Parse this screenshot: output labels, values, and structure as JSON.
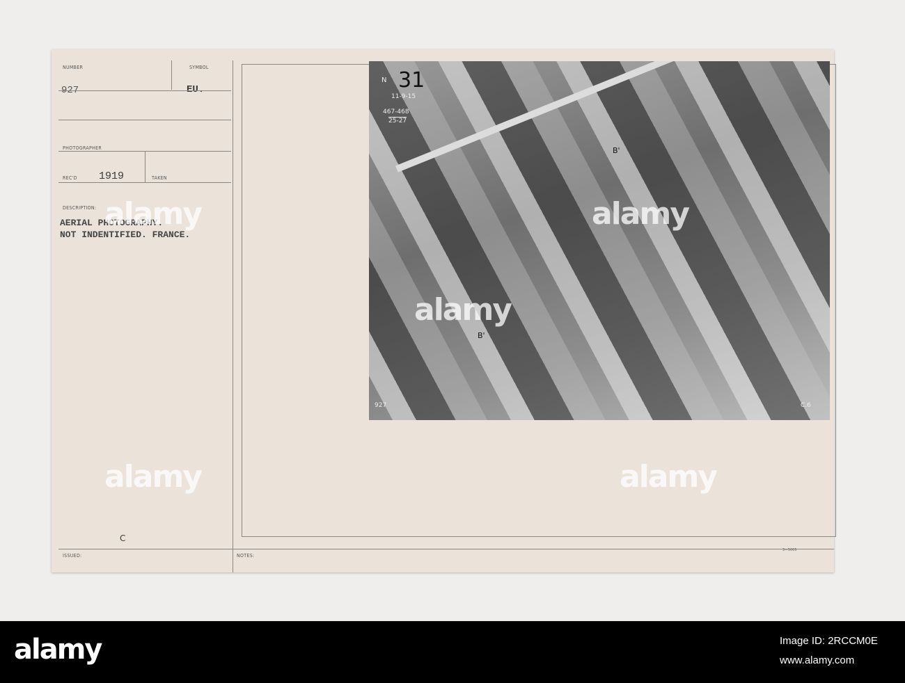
{
  "form": {
    "number_label": "NUMBER",
    "number_value": "927",
    "symbol_label": "SYMBOL",
    "symbol_value": "EU.",
    "photographer_label": "PHOTOGRAPHER",
    "recd_label": "REC'D",
    "recd_value": "1919",
    "taken_label": "TAKEN",
    "description_label": "DESCRIPTION:",
    "description_line1": "AERIAL PHOTOGRAPHY.",
    "description_line2": "NOT INDENTIFIED. FRANCE.",
    "class_mark": "C",
    "issued_label": "ISSUED:",
    "notes_label": "NOTES:",
    "form_code": "3—5005"
  },
  "photo": {
    "plate_number": "31",
    "north": "N",
    "date": "11-9-15",
    "ref1": "467-468",
    "ref2": "25-27",
    "marker1": "B'",
    "marker2": "B'",
    "corner_left": "927",
    "corner_right": "C.6"
  },
  "watermark": {
    "text": "alamy",
    "image_id": "Image ID: 2RCCM0E",
    "url": "www.alamy.com"
  }
}
